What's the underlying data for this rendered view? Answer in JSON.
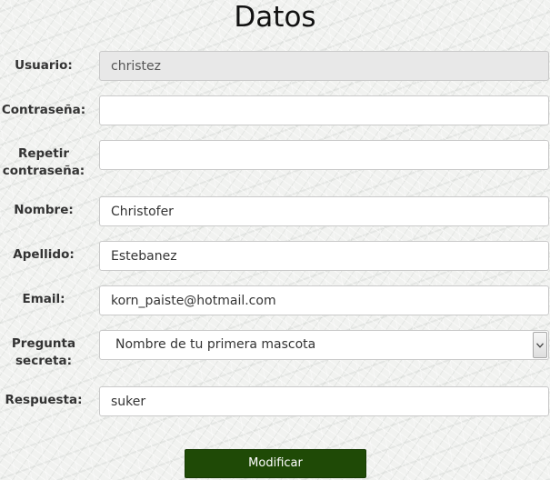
{
  "page": {
    "title": "Datos"
  },
  "form": {
    "usuario": {
      "label": "Usuario:",
      "value": "christez"
    },
    "contrasena": {
      "label": "Contraseña:",
      "value": ""
    },
    "repetir_contrasena": {
      "label_line1": "Repetir",
      "label_line2": "contraseña:",
      "value": ""
    },
    "nombre": {
      "label": "Nombre:",
      "value": "Christofer"
    },
    "apellido": {
      "label": "Apellido:",
      "value": "Estebanez"
    },
    "email": {
      "label": "Email:",
      "value": "korn_paiste@hotmail.com"
    },
    "pregunta": {
      "label_line1": "Pregunta",
      "label_line2": "secreta:",
      "selected": "Nombre de tu primera mascota"
    },
    "respuesta": {
      "label": "Respuesta:",
      "value": "suker"
    },
    "submit_label": "Modificar"
  },
  "colors": {
    "submit_background": "#1f4a06",
    "disabled_field": "#e8e8e8"
  },
  "icons": {
    "select_arrow": "chevron-down-icon"
  }
}
